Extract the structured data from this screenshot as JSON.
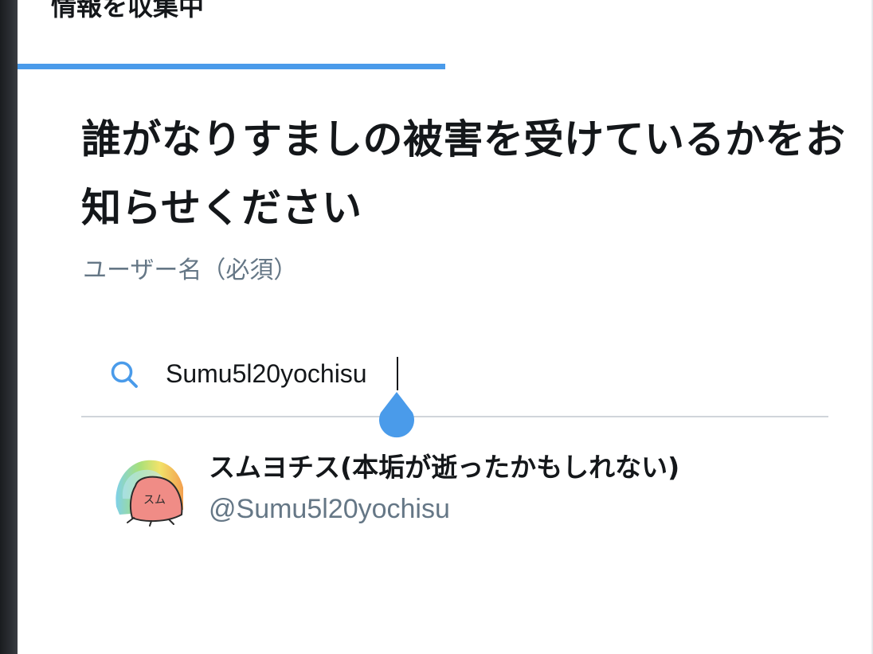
{
  "header": {
    "title": "情報を収集中"
  },
  "progress": {
    "value_percent": 50,
    "color": "#4a9bea"
  },
  "main": {
    "heading": "誰がなりすましの被害を受けているかをお知らせください",
    "field_label": "ユーザー名（必須）"
  },
  "search": {
    "icon": "search-icon",
    "value": "Sumu5l20yochisu",
    "accent_color": "#4a9bea"
  },
  "results": [
    {
      "display_name": "スムヨチス(本垢が逝ったかもしれない)",
      "handle": "@Sumu5l20yochisu",
      "avatar_text": "スム"
    }
  ],
  "colors": {
    "text_primary": "#14171a",
    "text_secondary": "#657786",
    "divider": "#d0d5da"
  }
}
